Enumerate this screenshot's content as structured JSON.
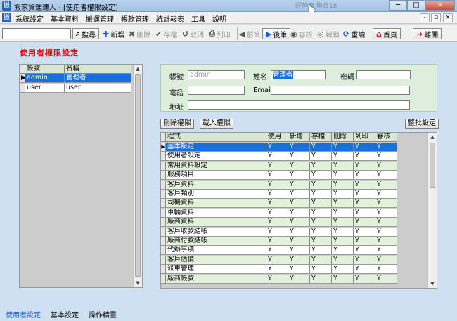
{
  "window": {
    "title": "搬家貨運達人 - [使用者權限設定]",
    "app_icon": "搬",
    "ghost_text": "經營商 搬貨18",
    "minimize": "─",
    "maximize": "□",
    "close": "✕"
  },
  "menu": {
    "items": [
      "系統設定",
      "基本資料",
      "搬運管理",
      "帳款管理",
      "統計報表",
      "工具",
      "說明"
    ],
    "mdi_minimize": "-",
    "mdi_restore": "▫",
    "mdi_close": "×"
  },
  "toolbar": {
    "search_value": "",
    "search_label": "搜尋",
    "add_label": "新增",
    "delete_label": "刪除",
    "save_label": "存檔",
    "cancel_label": "取消",
    "print_label": "列印",
    "prev_label": "前筆",
    "next_label": "後筆",
    "review_label": "審核",
    "unlock_label": "解鎖",
    "reload_label": "重讀",
    "home_label": "首頁",
    "exit_label": "離開"
  },
  "page": {
    "heading": "使用者權限設定"
  },
  "users": {
    "headers": [
      "帳號",
      "名稱"
    ],
    "rows": [
      {
        "account": "admin",
        "name": "管理者",
        "selected": true
      },
      {
        "account": "user",
        "name": "user",
        "selected": false
      }
    ]
  },
  "form": {
    "account_label": "帳號",
    "account_value": "admin",
    "name_label": "姓名",
    "name_value": "管理者",
    "password_label": "密碼",
    "password_value": "",
    "phone_label": "電話",
    "phone_value": "",
    "email_label": "Email",
    "email_value": "",
    "address_label": "地址",
    "address_value": ""
  },
  "actions": {
    "delete_permission": "刪除權限",
    "load_permission": "載入權限",
    "batch_set": "整批設定"
  },
  "permissions": {
    "headers": [
      "程式",
      "使用",
      "新增",
      "存檔",
      "刪除",
      "列印",
      "審核"
    ],
    "rows": [
      [
        "基本設定",
        "Y",
        "Y",
        "Y",
        "Y",
        "Y",
        "Y"
      ],
      [
        "使用者設定",
        "Y",
        "Y",
        "Y",
        "Y",
        "Y",
        "Y"
      ],
      [
        "常用資料設定",
        "Y",
        "Y",
        "Y",
        "Y",
        "Y",
        "Y"
      ],
      [
        "服務項目",
        "Y",
        "Y",
        "Y",
        "Y",
        "Y",
        "Y"
      ],
      [
        "客戶資料",
        "Y",
        "Y",
        "Y",
        "Y",
        "Y",
        "Y"
      ],
      [
        "客戶類別",
        "Y",
        "Y",
        "Y",
        "Y",
        "Y",
        "Y"
      ],
      [
        "司機資料",
        "Y",
        "Y",
        "Y",
        "Y",
        "Y",
        "Y"
      ],
      [
        "車輛資料",
        "Y",
        "Y",
        "Y",
        "Y",
        "Y",
        "Y"
      ],
      [
        "廠商資料",
        "Y",
        "Y",
        "Y",
        "Y",
        "Y",
        "Y"
      ],
      [
        "客戶收款結帳",
        "Y",
        "Y",
        "Y",
        "Y",
        "Y",
        "Y"
      ],
      [
        "廠商付款結帳",
        "Y",
        "Y",
        "Y",
        "Y",
        "Y",
        "Y"
      ],
      [
        "代辦事項",
        "Y",
        "Y",
        "Y",
        "Y",
        "Y",
        "Y"
      ],
      [
        "客戶估價",
        "Y",
        "Y",
        "Y",
        "Y",
        "Y",
        "Y"
      ],
      [
        "派車管理",
        "Y",
        "Y",
        "Y",
        "Y",
        "Y",
        "Y"
      ],
      [
        "廠商帳款",
        "Y",
        "Y",
        "Y",
        "Y",
        "Y",
        "Y"
      ]
    ]
  },
  "status": {
    "items": [
      "使用者設定",
      "基本設定",
      "操作精靈"
    ]
  },
  "colors": {
    "heading": "#e01010",
    "selection": "#1a6fe0",
    "grid_alt": "#e2f2da",
    "background": "#cfe0f2"
  }
}
